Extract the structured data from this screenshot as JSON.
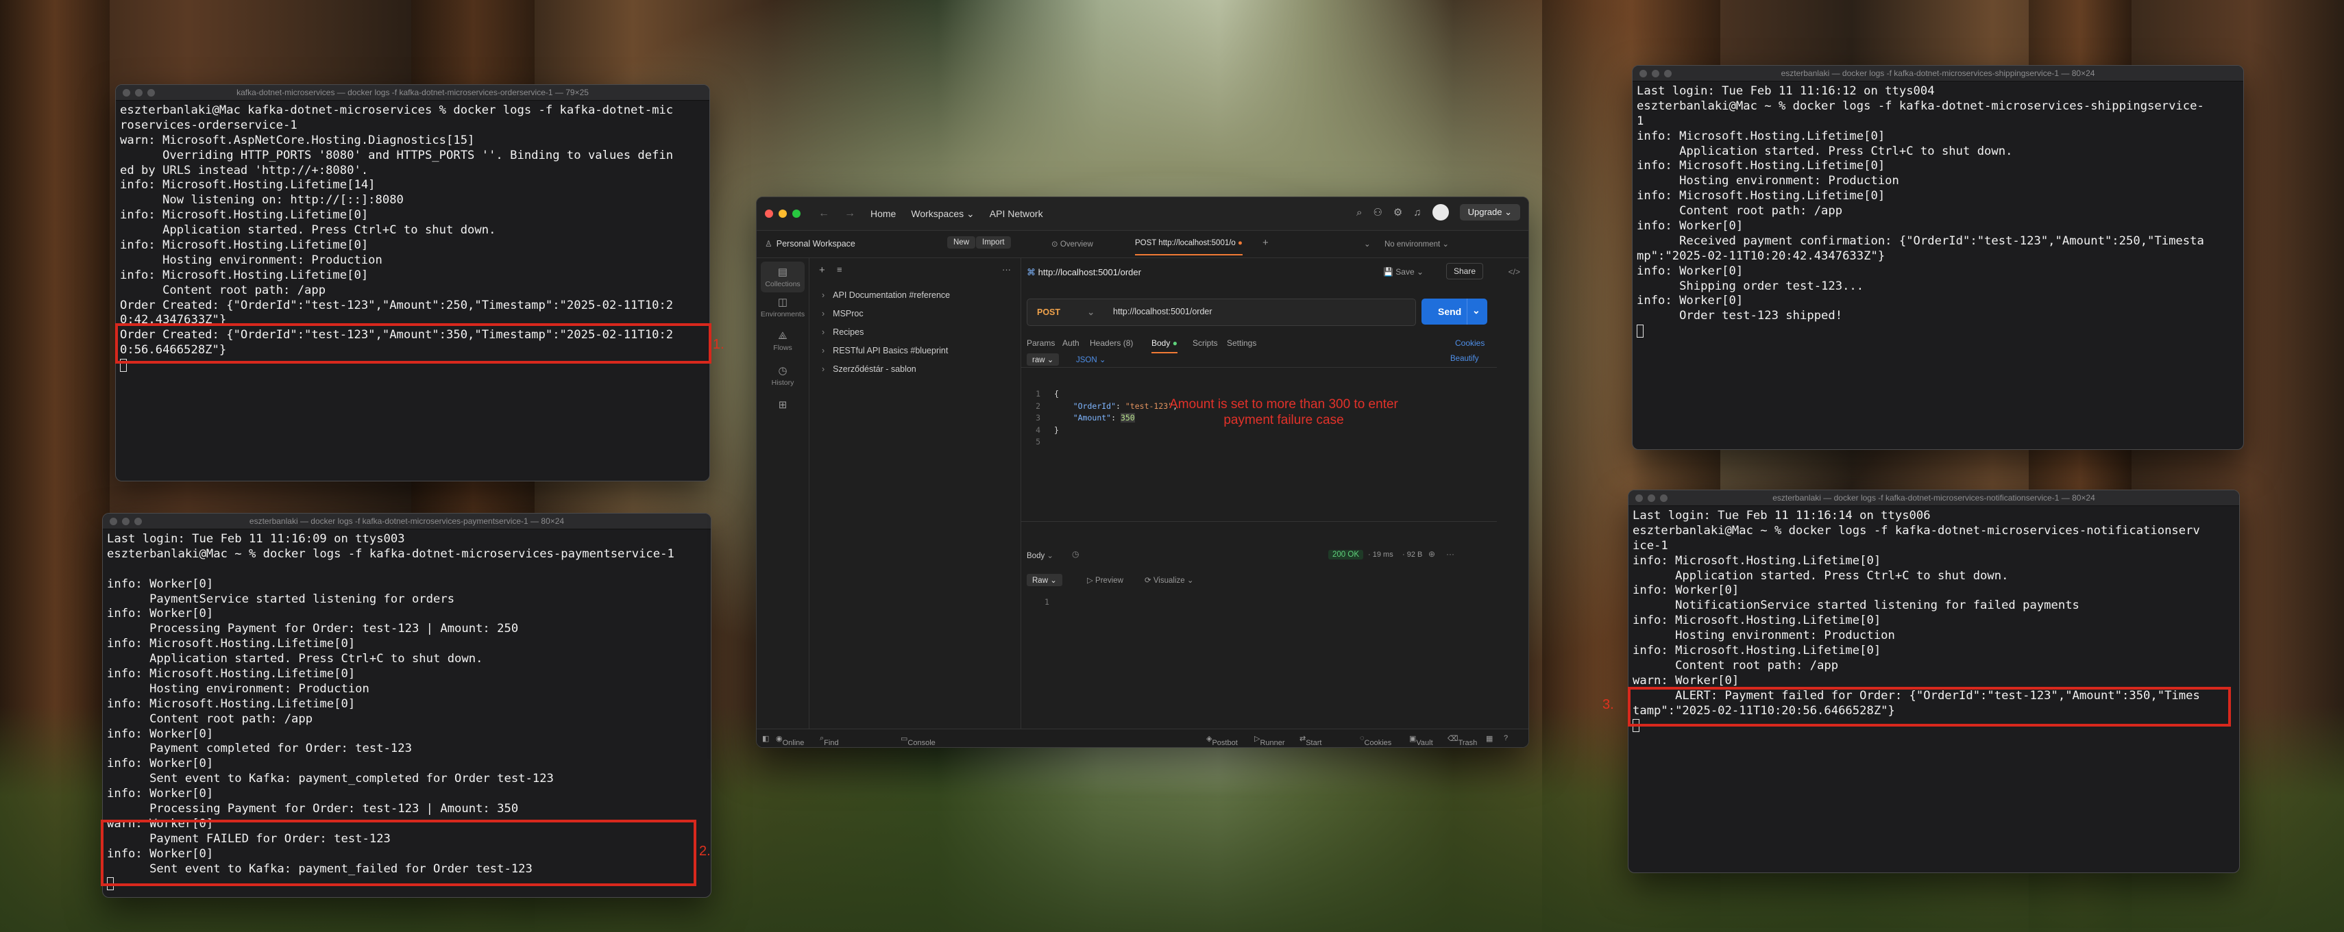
{
  "terminals": {
    "order": {
      "title": "kafka-dotnet-microservices — docker logs -f kafka-dotnet-microservices-orderservice-1 — 79×25",
      "lines": [
        "eszterbanlaki@Mac kafka-dotnet-microservices % docker logs -f kafka-dotnet-mic",
        "roservices-orderservice-1",
        "warn: Microsoft.AspNetCore.Hosting.Diagnostics[15]",
        "      Overriding HTTP_PORTS '8080' and HTTPS_PORTS ''. Binding to values defin",
        "ed by URLS instead 'http://+:8080'.",
        "info: Microsoft.Hosting.Lifetime[14]",
        "      Now listening on: http://[::]:8080",
        "info: Microsoft.Hosting.Lifetime[0]",
        "      Application started. Press Ctrl+C to shut down.",
        "info: Microsoft.Hosting.Lifetime[0]",
        "      Hosting environment: Production",
        "info: Microsoft.Hosting.Lifetime[0]",
        "      Content root path: /app",
        "Order Created: {\"OrderId\":\"test-123\",\"Amount\":250,\"Timestamp\":\"2025-02-11T10:2",
        "0:42.4347633Z\"}",
        "Order Created: {\"OrderId\":\"test-123\",\"Amount\":350,\"Timestamp\":\"2025-02-11T10:2",
        "0:56.6466528Z\"}"
      ],
      "step": "1."
    },
    "payment": {
      "title": "eszterbanlaki — docker logs -f kafka-dotnet-microservices-paymentservice-1 — 80×24",
      "lines": [
        "Last login: Tue Feb 11 11:16:09 on ttys003",
        "eszterbanlaki@Mac ~ % docker logs -f kafka-dotnet-microservices-paymentservice-1",
        "",
        "info: Worker[0]",
        "      PaymentService started listening for orders",
        "info: Worker[0]",
        "      Processing Payment for Order: test-123 | Amount: 250",
        "info: Microsoft.Hosting.Lifetime[0]",
        "      Application started. Press Ctrl+C to shut down.",
        "info: Microsoft.Hosting.Lifetime[0]",
        "      Hosting environment: Production",
        "info: Microsoft.Hosting.Lifetime[0]",
        "      Content root path: /app",
        "info: Worker[0]",
        "      Payment completed for Order: test-123",
        "info: Worker[0]",
        "      Sent event to Kafka: payment_completed for Order test-123",
        "info: Worker[0]",
        "      Processing Payment for Order: test-123 | Amount: 350",
        "warn: Worker[0]",
        "      Payment FAILED for Order: test-123",
        "info: Worker[0]",
        "      Sent event to Kafka: payment_failed for Order test-123"
      ],
      "step": "2."
    },
    "shipping": {
      "title": "eszterbanlaki — docker logs -f kafka-dotnet-microservices-shippingservice-1 — 80×24",
      "lines": [
        "Last login: Tue Feb 11 11:16:12 on ttys004",
        "eszterbanlaki@Mac ~ % docker logs -f kafka-dotnet-microservices-shippingservice-",
        "1",
        "info: Microsoft.Hosting.Lifetime[0]",
        "      Application started. Press Ctrl+C to shut down.",
        "info: Microsoft.Hosting.Lifetime[0]",
        "      Hosting environment: Production",
        "info: Microsoft.Hosting.Lifetime[0]",
        "      Content root path: /app",
        "info: Worker[0]",
        "      Received payment confirmation: {\"OrderId\":\"test-123\",\"Amount\":250,\"Timesta",
        "mp\":\"2025-02-11T10:20:42.4347633Z\"}",
        "info: Worker[0]",
        "      Shipping order test-123...",
        "info: Worker[0]",
        "      Order test-123 shipped!"
      ]
    },
    "notification": {
      "title": "eszterbanlaki — docker logs -f kafka-dotnet-microservices-notificationservice-1 — 80×24",
      "lines": [
        "Last login: Tue Feb 11 11:16:14 on ttys006",
        "eszterbanlaki@Mac ~ % docker logs -f kafka-dotnet-microservices-notificationserv",
        "ice-1",
        "info: Microsoft.Hosting.Lifetime[0]",
        "      Application started. Press Ctrl+C to shut down.",
        "info: Worker[0]",
        "      NotificationService started listening for failed payments",
        "info: Microsoft.Hosting.Lifetime[0]",
        "      Hosting environment: Production",
        "info: Microsoft.Hosting.Lifetime[0]",
        "      Content root path: /app",
        "warn: Worker[0]",
        "      ALERT: Payment failed for Order: {\"OrderId\":\"test-123\",\"Amount\":350,\"Times",
        "tamp\":\"2025-02-11T10:20:56.6466528Z\"}"
      ],
      "step": "3."
    }
  },
  "postman": {
    "nav": {
      "home": "Home",
      "workspaces": "Workspaces",
      "api_network": "API Network",
      "upgrade": "Upgrade"
    },
    "workspace": {
      "name": "Personal Workspace",
      "new": "New",
      "import": "Import"
    },
    "rail": [
      "Collections",
      "Environments",
      "Flows",
      "History"
    ],
    "collections": [
      "API Documentation #reference",
      "MSProc",
      "Recipes",
      "RESTful API Basics #blueprint",
      "Szerződéstár - sablon"
    ],
    "tabs": {
      "overview": "Overview",
      "request_tab": "POST http://localhost:5001/o",
      "env": "No environment"
    },
    "request": {
      "title": "http://localhost:5001/order",
      "save": "Save",
      "share": "Share",
      "method": "POST",
      "url": "http://localhost:5001/order",
      "send": "Send",
      "tabs": [
        "Params",
        "Auth",
        "Headers (8)",
        "Body",
        "Scripts",
        "Settings"
      ],
      "cookies": "Cookies",
      "body_mode": "raw",
      "body_lang": "JSON",
      "beautify": "Beautify",
      "code_lines": [
        "1",
        "2",
        "3",
        "4",
        "5"
      ],
      "code": {
        "open": "{",
        "key1": "\"OrderId\"",
        "val1": "\"test-123\"",
        "key2": "\"Amount\"",
        "val2": "350",
        "close": "}"
      },
      "note": "Amount is set to more than 300 to enter payment failure case"
    },
    "response": {
      "label": "Body",
      "status": "200 OK",
      "time": "19 ms",
      "size": "92 B",
      "view": "Raw",
      "preview": "Preview",
      "visualize": "Visualize",
      "line": "1"
    },
    "statusbar": {
      "online": "Online",
      "find": "Find and replace",
      "console": "Console",
      "postbot": "Postbot",
      "runner": "Runner",
      "proxy": "Start Proxy",
      "cookies": "Cookies",
      "vault": "Vault",
      "trash": "Trash"
    }
  },
  "colors": {
    "highlight": "#d8281d",
    "send": "#1f6fdc",
    "method": "#f0a24b",
    "status_ok": "#5fd27b",
    "note": "#e2322a"
  }
}
